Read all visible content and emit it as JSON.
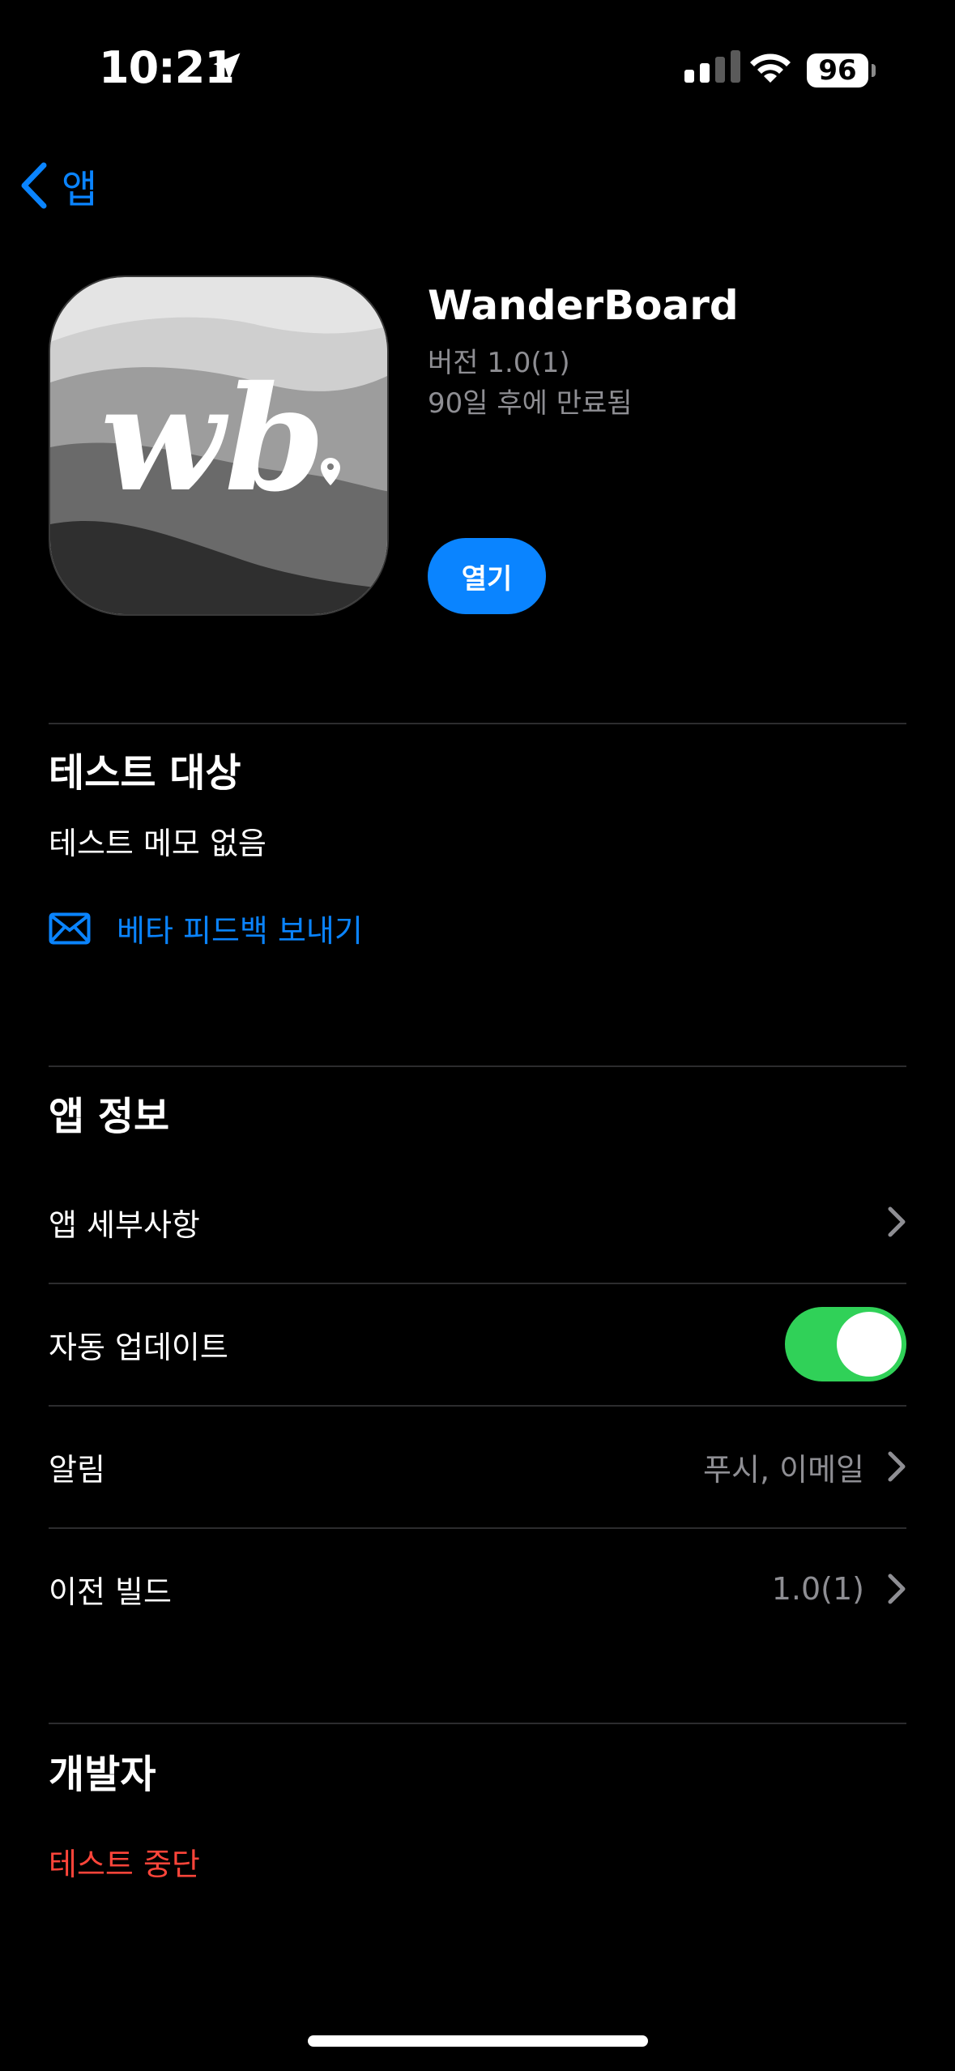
{
  "status_bar": {
    "time": "10:21",
    "battery": "96"
  },
  "nav": {
    "back_label": "앱"
  },
  "app": {
    "name": "WanderBoard",
    "version": "버전 1.0(1)",
    "expiry": "90일 후에 만료됨",
    "open_label": "열기",
    "icon_text": "wb"
  },
  "testing": {
    "title": "테스트 대상",
    "notes": "테스트 메모 없음",
    "feedback_label": "베타 피드백 보내기"
  },
  "app_info": {
    "title": "앱 정보",
    "rows": [
      {
        "label": "앱 세부사항",
        "value": ""
      },
      {
        "label": "자동 업데이트",
        "toggle": true
      },
      {
        "label": "알림",
        "value": "푸시, 이메일"
      },
      {
        "label": "이전 빌드",
        "value": "1.0(1)"
      }
    ]
  },
  "developer": {
    "title": "개발자",
    "stop_label": "테스트 중단"
  },
  "colors": {
    "accent": "#0a84ff",
    "toggle_on": "#30d158",
    "destructive": "#ff453a",
    "secondary_text": "#8e8e93"
  }
}
